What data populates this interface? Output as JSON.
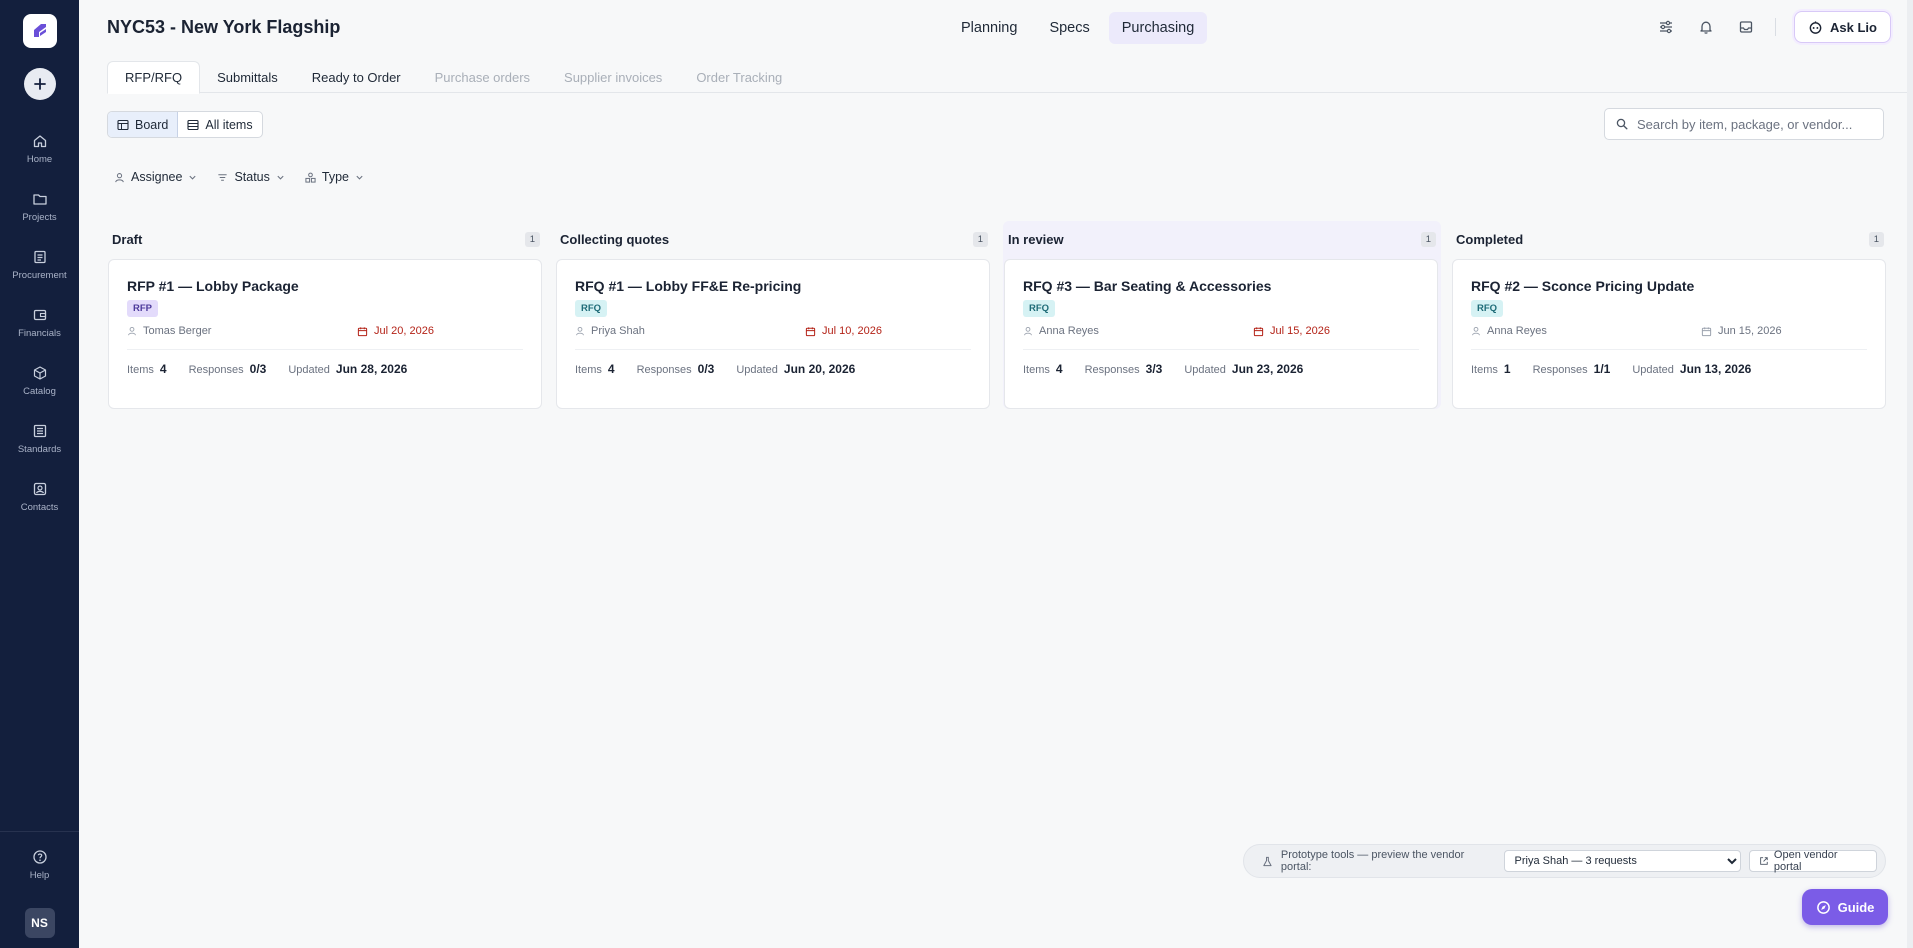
{
  "sidebar": {
    "items": [
      {
        "label": "Home",
        "icon": "home-icon"
      },
      {
        "label": "Projects",
        "icon": "folder-icon"
      },
      {
        "label": "Procurement",
        "icon": "clipboard-icon"
      },
      {
        "label": "Financials",
        "icon": "wallet-icon"
      },
      {
        "label": "Catalog",
        "icon": "cube-icon"
      },
      {
        "label": "Standards",
        "icon": "list-icon"
      },
      {
        "label": "Contacts",
        "icon": "contact-icon"
      }
    ],
    "help_label": "Help",
    "avatar_initials": "NS"
  },
  "header": {
    "project_title": "NYC53 - New York Flagship",
    "tabs": [
      "Planning",
      "Specs",
      "Purchasing"
    ],
    "active_tab": "Purchasing",
    "ask_label": "Ask Lio"
  },
  "subtabs": [
    {
      "label": "RFP/RFQ",
      "state": "active"
    },
    {
      "label": "Submittals",
      "state": "normal"
    },
    {
      "label": "Ready to Order",
      "state": "normal"
    },
    {
      "label": "Purchase orders",
      "state": "disabled"
    },
    {
      "label": "Supplier invoices",
      "state": "disabled"
    },
    {
      "label": "Order Tracking",
      "state": "disabled"
    }
  ],
  "toolbar": {
    "board_label": "Board",
    "all_items_label": "All items",
    "search_placeholder": "Search by item, package, or vendor..."
  },
  "filters": [
    "Assignee",
    "Status",
    "Type"
  ],
  "columns": [
    {
      "title": "Draft",
      "count": "1",
      "highlight": false,
      "card": {
        "title": "RFP #1 — Lobby Package",
        "badge": "RFP",
        "assignee": "Tomas Berger",
        "due": "Jul 20, 2026",
        "due_overdue": true,
        "items_label": "Items",
        "items": "4",
        "responses_label": "Responses",
        "responses": "0/3",
        "updated_label": "Updated",
        "updated": "Jun 28, 2026"
      }
    },
    {
      "title": "Collecting quotes",
      "count": "1",
      "highlight": false,
      "card": {
        "title": "RFQ #1 — Lobby FF&E Re-pricing",
        "badge": "RFQ",
        "assignee": "Priya Shah",
        "due": "Jul 10, 2026",
        "due_overdue": true,
        "items_label": "Items",
        "items": "4",
        "responses_label": "Responses",
        "responses": "0/3",
        "updated_label": "Updated",
        "updated": "Jun 20, 2026"
      }
    },
    {
      "title": "In review",
      "count": "1",
      "highlight": true,
      "card": {
        "title": "RFQ #3 — Bar Seating & Accessories",
        "badge": "RFQ",
        "assignee": "Anna Reyes",
        "due": "Jul 15, 2026",
        "due_overdue": true,
        "items_label": "Items",
        "items": "4",
        "responses_label": "Responses",
        "responses": "3/3",
        "updated_label": "Updated",
        "updated": "Jun 23, 2026"
      }
    },
    {
      "title": "Completed",
      "count": "1",
      "highlight": false,
      "card": {
        "title": "RFQ #2 — Sconce Pricing Update",
        "badge": "RFQ",
        "assignee": "Anna Reyes",
        "due": "Jun 15, 2026",
        "due_overdue": false,
        "items_label": "Items",
        "items": "1",
        "responses_label": "Responses",
        "responses": "1/1",
        "updated_label": "Updated",
        "updated": "Jun 13, 2026"
      }
    }
  ],
  "prototype": {
    "label": "Prototype tools — preview the vendor portal:",
    "selected": "Priya Shah — 3 requests",
    "open_label": "Open vendor portal"
  },
  "guide_label": "Guide",
  "colors": {
    "sidebar": "#131f3d",
    "accent": "#7b5ce7",
    "overdue": "#b42318"
  }
}
